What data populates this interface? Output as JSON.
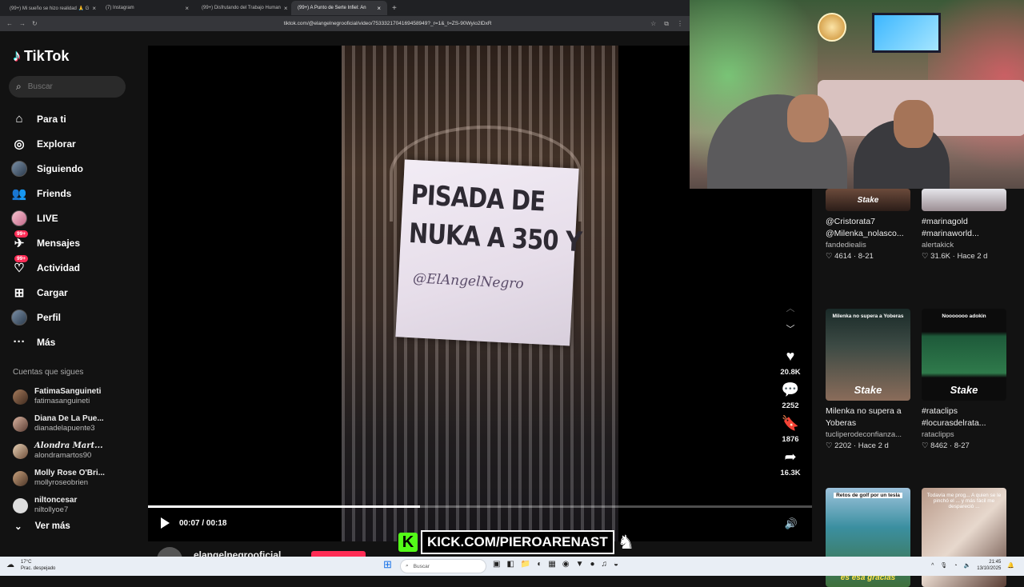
{
  "browser": {
    "tabs": [
      {
        "label": "(99+) Mi sueño se hizo realidad 🙏 G",
        "active": false
      },
      {
        "label": "(7) Instagram",
        "active": false
      },
      {
        "label": "(99+) Disfrutando del Trabajo Human",
        "active": false
      },
      {
        "label": "(99+) A Punto de Serte Infiel: An",
        "active": true
      }
    ],
    "url": "tiktok.com/@elangelnegrooficial/video/7533321704169458949?_r=1&_t=ZS-90Wyio2lDxR"
  },
  "tiktok": {
    "logo_text": "TikTok",
    "search_placeholder": "Buscar",
    "nav": [
      {
        "label": "Para ti",
        "icon": "home-icon"
      },
      {
        "label": "Explorar",
        "icon": "compass-icon"
      },
      {
        "label": "Siguiendo",
        "icon": "avatar"
      },
      {
        "label": "Friends",
        "icon": "friends-icon"
      },
      {
        "label": "LIVE",
        "icon": "avatar"
      },
      {
        "label": "Mensajes",
        "icon": "message-icon",
        "badge": "99+"
      },
      {
        "label": "Actividad",
        "icon": "activity-icon",
        "badge": "99+"
      },
      {
        "label": "Cargar",
        "icon": "upload-icon"
      },
      {
        "label": "Perfil",
        "icon": "avatar"
      },
      {
        "label": "Más",
        "icon": "more-icon"
      }
    ],
    "following_title": "Cuentas que sigues",
    "following": [
      {
        "name": "FatimaSanguineti",
        "handle": "fatimasanguineti"
      },
      {
        "name": "Diana De La Pue...",
        "handle": "dianadelapuente3"
      },
      {
        "name": "Alondra Mart...",
        "handle": "alondramartos90"
      },
      {
        "name": "Molly Rose O'Bri...",
        "handle": "mollyroseobrien"
      },
      {
        "name": "niltoncesar",
        "handle": "niltollyoe7"
      }
    ],
    "see_more": "Ver más"
  },
  "video": {
    "sign_lines": [
      "PISADA DE",
      "NUKA A 350 Y"
    ],
    "sign_signature": "@ElAngelNegro",
    "time": "00:07 / 00:18",
    "progress": 0.41,
    "author": "elangelnegrooficial",
    "actions": {
      "likes": "20.8K",
      "comments": "2252",
      "saves": "1876",
      "shares": "16.3K"
    }
  },
  "overlay": {
    "kick_text": "KICK.COM/PIEROARENAST",
    "k_letter": "K"
  },
  "related": [
    {
      "title": "@Cristorata7 @Milenka_nolasco...",
      "author": "fandediealis",
      "likes": "4614",
      "date": "8-21",
      "caption": "",
      "brand": "Stake"
    },
    {
      "title": "#marinagold #marinaworld...",
      "author": "alertakick",
      "likes": "31.6K",
      "date": "Hace 2 d",
      "caption": "",
      "brand": ""
    },
    {
      "title": "Milenka no supera a Yoberas",
      "author": "tucliperodeconfianza...",
      "likes": "2202",
      "date": "Hace 2 d",
      "caption": "Milenka no supera a Yoberas",
      "brand": "Stake"
    },
    {
      "title": "#rataclips #locurasdelrata...",
      "author": "rataclipps",
      "likes": "8462",
      "date": "8-27",
      "caption": "Nooooooo adokin",
      "brand": "Stake"
    },
    {
      "title": "",
      "author": "",
      "likes": "",
      "date": "",
      "caption": "Retos de golf por un tesla",
      "brand": "es esa gracias"
    },
    {
      "title": "",
      "author": "",
      "likes": "",
      "date": "",
      "caption": "Todavía me prog... A quien se le pinchó el ... y más fácil me despareció ... ",
      "brand": ""
    }
  ],
  "taskbar": {
    "weather_temp": "17°C",
    "weather_desc": "Prac. despejado",
    "search": "Buscar",
    "time": "21:45",
    "date": "13/10/2025"
  }
}
